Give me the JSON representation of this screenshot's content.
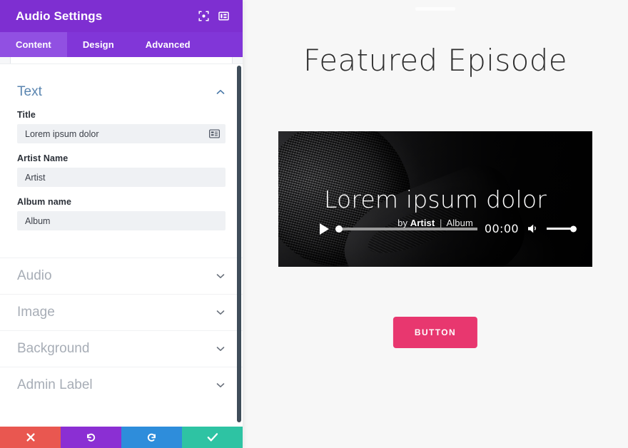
{
  "panel": {
    "title": "Audio Settings",
    "header_icons": [
      {
        "name": "focus-target-icon"
      },
      {
        "name": "layout-panel-icon"
      }
    ],
    "tabs": [
      {
        "label": "Content",
        "active": true
      },
      {
        "label": "Design",
        "active": false
      },
      {
        "label": "Advanced",
        "active": false
      }
    ],
    "open_section": {
      "label": "Text",
      "toggle_icon": "chevron-up-icon",
      "fields": [
        {
          "label": "Title",
          "value": "Lorem ipsum dolor",
          "placeholder": "Title",
          "has_dynamic_icon": true
        },
        {
          "label": "Artist Name",
          "value": "Artist",
          "placeholder": "Artist",
          "has_dynamic_icon": false
        },
        {
          "label": "Album name",
          "value": "Album",
          "placeholder": "Album",
          "has_dynamic_icon": false
        }
      ]
    },
    "collapsed_sections": [
      {
        "label": "Audio",
        "toggle_icon": "chevron-down-icon"
      },
      {
        "label": "Image",
        "toggle_icon": "chevron-down-icon"
      },
      {
        "label": "Background",
        "toggle_icon": "chevron-down-icon"
      },
      {
        "label": "Admin Label",
        "toggle_icon": "chevron-down-icon"
      }
    ],
    "actions": [
      {
        "name": "cancel",
        "icon": "close-x-icon",
        "color": "#e95750"
      },
      {
        "name": "undo",
        "icon": "undo-arrow-icon",
        "color": "#8b2fd3"
      },
      {
        "name": "redo",
        "icon": "redo-arrow-icon",
        "color": "#2e8ddb"
      },
      {
        "name": "save",
        "icon": "checkmark-icon",
        "color": "#2ec3a3"
      }
    ],
    "colors": {
      "header": "#7e2fd1",
      "tab_bar": "#8136d8",
      "tab_active": "#9150e2",
      "section_open_label": "#5a85b0",
      "section_collapsed_label": "#a7adb6"
    }
  },
  "preview": {
    "heading": "Featured Episode",
    "player": {
      "title": "Lorem ipsum dolor",
      "by_prefix": "by",
      "artist": "Artist",
      "separator": "|",
      "album": "Album",
      "play_icon": "play-triangle-icon",
      "time": "00:00",
      "volume_icon": "speaker-volume-icon",
      "progress_percent": 0,
      "volume_percent": 100
    },
    "cta_button": {
      "label": "BUTTON",
      "color": "#e8376f"
    },
    "fab": {
      "icon": "ellipsis-horizontal-icon",
      "color": "#7b2fc4"
    },
    "background_color": "#f7f7f7"
  }
}
